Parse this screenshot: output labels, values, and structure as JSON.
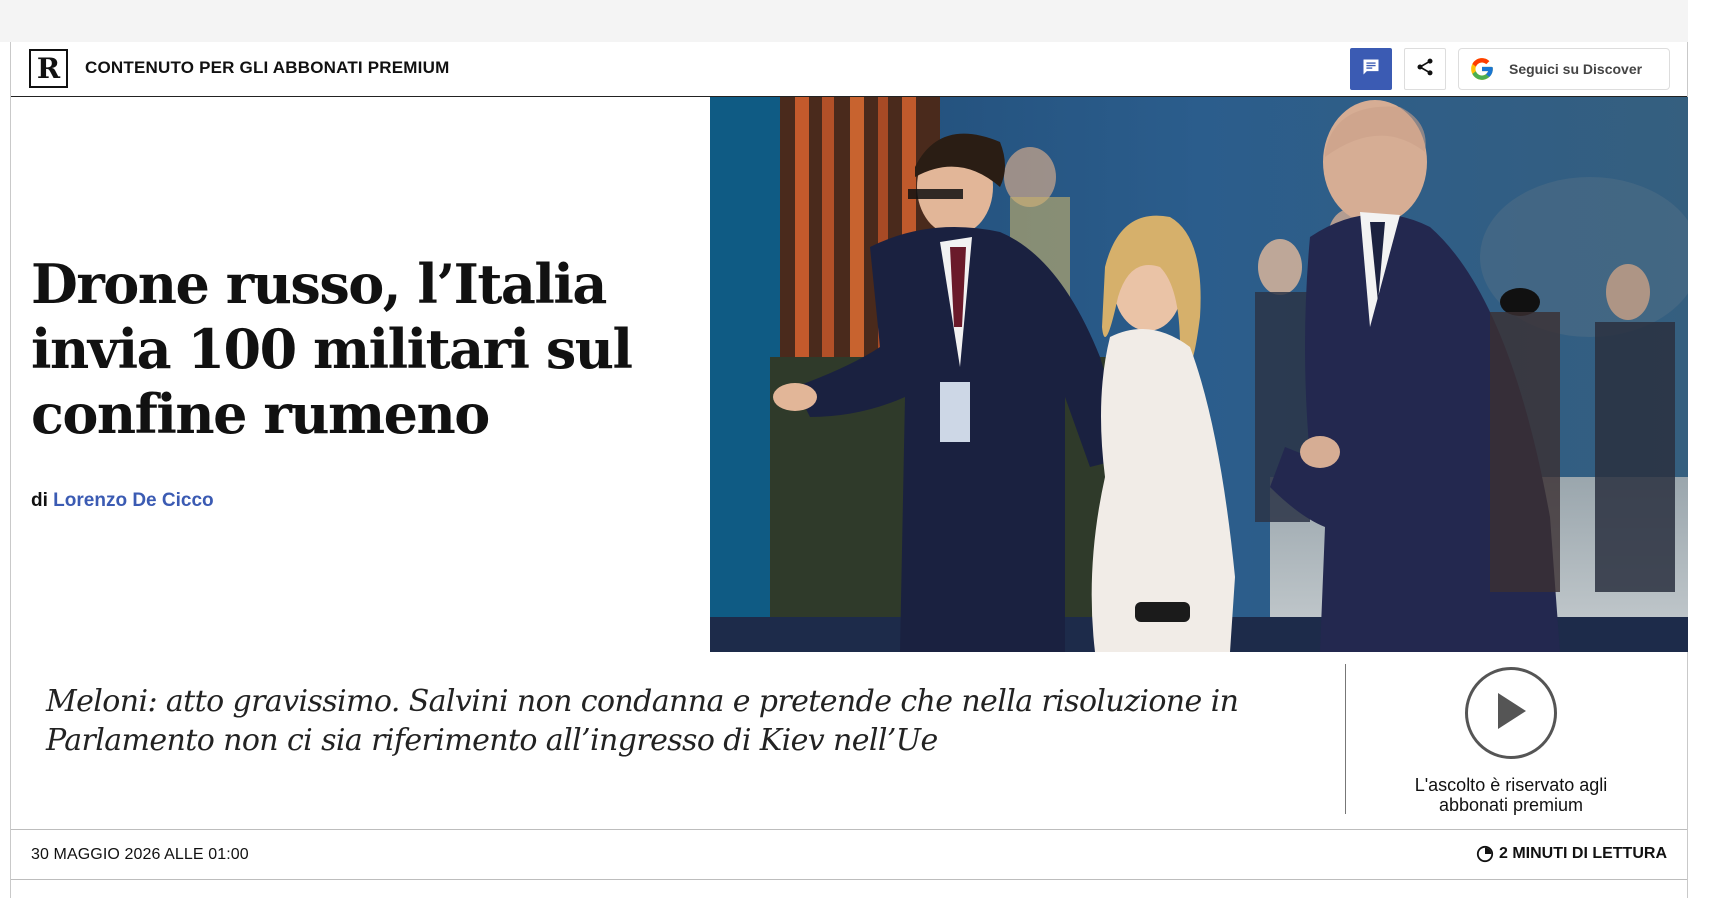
{
  "header": {
    "logo": "R",
    "premium_label": "CONTENUTO PER GLI ABBONATI PREMIUM",
    "discover_label": "Seguici su Discover"
  },
  "article": {
    "headline": "Drone russo, l’Italia invia 100 militari sul confine rumeno",
    "byline_prefix": "di",
    "author": "Lorenzo De Cicco",
    "subtitle": "Meloni: atto gravissimo. Salvini non condanna e pretende che nella risoluzione in Parlamento non ci sia riferimento all’ingresso di Kiev nell’Ue",
    "date": "30 MAGGIO 2026 ALLE 01:00",
    "reading_time": "2 MINUTI DI LETTURA"
  },
  "audio": {
    "note": "L'ascolto è riservato agli abbonati premium"
  },
  "colors": {
    "accent": "#3b5bb3",
    "text": "#111111"
  },
  "icons": [
    "comment-icon",
    "share-icon",
    "google-icon",
    "play-icon",
    "clock-icon"
  ]
}
